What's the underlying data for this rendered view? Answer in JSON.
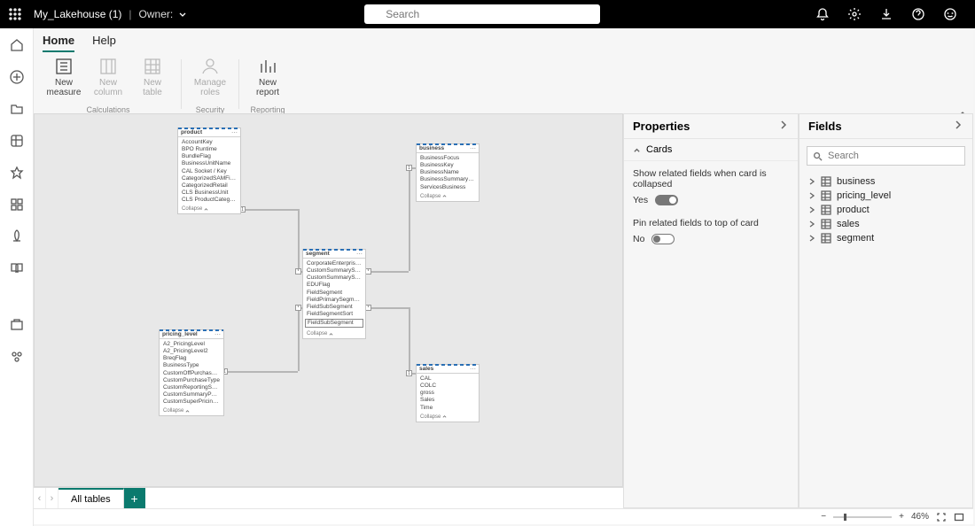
{
  "topbar": {
    "title": "My_Lakehouse (1)",
    "owner_label": "Owner:",
    "search_placeholder": "Search"
  },
  "tabs": {
    "home": "Home",
    "help": "Help"
  },
  "ribbon": {
    "new_measure": "New\nmeasure",
    "new_column": "New\ncolumn",
    "new_table": "New\ntable",
    "manage_roles": "Manage\nroles",
    "new_report": "New\nreport",
    "grp_calc": "Calculations",
    "grp_sec": "Security",
    "grp_rep": "Reporting"
  },
  "tables": {
    "product": {
      "name": "product",
      "rows": [
        "AccountKey",
        "BPO Runtime",
        "BundleFlag",
        "BusinessUnitName",
        "CAL Socket / Key",
        "CategorizedSAMField",
        "CategorizedRetail",
        "CLS BusinessUnit",
        "CLS ProductCategoryAndServices"
      ],
      "collapse": "Collapse"
    },
    "business": {
      "name": "business",
      "rows": [
        "BusinessFocus",
        "BusinessKey",
        "BusinessName",
        "BusinessSummaryName",
        "ServicesBusiness"
      ],
      "collapse": "Collapse"
    },
    "segment": {
      "name": "segment",
      "rows": [
        "CorporateEnterpriseFlag",
        "CustomSummarySector",
        "CustomSummarySegment",
        "EDUFlag",
        "FieldSegment",
        "FieldPrimarySegment",
        "FieldSubSegment",
        "FieldSegmentSort",
        "FieldSubSegment"
      ],
      "collapse": "Collapse"
    },
    "pricing": {
      "name": "pricing_level",
      "rows": [
        "A2_PricingLevel",
        "A2_PricingLevel2",
        "BreqFlag",
        "BusinessType",
        "CustomOffPurchaseType",
        "CustomPurchaseType",
        "CustomReportingSummaryPurc",
        "CustomSummaryPurchaseType",
        "CustomSuperPricingLevel"
      ],
      "collapse": "Collapse"
    },
    "sales": {
      "name": "sales",
      "rows": [
        "CAL",
        "COLC",
        "gross",
        "Sales",
        "Time"
      ],
      "collapse": "Collapse"
    }
  },
  "bottom": {
    "all_tables": "All tables"
  },
  "props": {
    "title": "Properties",
    "cards": "Cards",
    "show_related": "Show related fields when card is collapsed",
    "yes": "Yes",
    "pin_related": "Pin related fields to top of card",
    "no": "No"
  },
  "fields": {
    "title": "Fields",
    "search_placeholder": "Search",
    "items": [
      "business",
      "pricing_level",
      "product",
      "sales",
      "segment"
    ]
  },
  "status": {
    "zoom": "46%"
  }
}
